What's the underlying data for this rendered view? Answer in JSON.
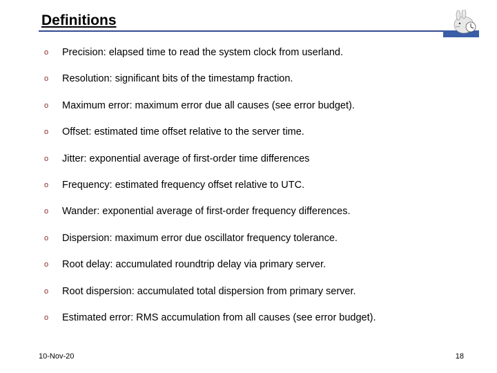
{
  "title": "Definitions",
  "bullets": [
    "Precision: elapsed time to read the system clock from userland.",
    "Resolution: significant bits of the timestamp fraction.",
    "Maximum error: maximum error due all causes (see error budget).",
    "Offset: estimated time offset relative to the server time.",
    "Jitter: exponential average of first-order time differences",
    "Frequency: estimated frequency offset relative to UTC.",
    "Wander: exponential average of first-order frequency differences.",
    "Dispersion: maximum error due oscillator frequency tolerance.",
    "Root delay: accumulated roundtrip delay via primary server.",
    "Root dispersion: accumulated total dispersion from primary server.",
    "Estimated error: RMS accumulation from all causes (see error budget)."
  ],
  "bullet_marker": "o",
  "footer": {
    "date": "10-Nov-20",
    "page": "18"
  }
}
